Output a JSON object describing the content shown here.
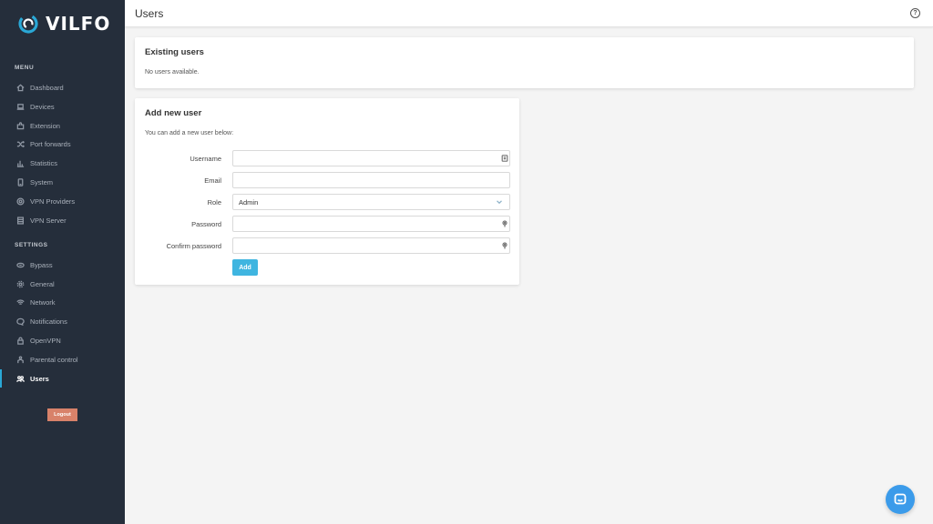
{
  "brand": {
    "name": "VILFO",
    "logo_icon": "vilfo-logo-icon"
  },
  "sidebar": {
    "menu_title": "MENU",
    "menu_items": [
      {
        "label": "Dashboard",
        "icon": "home-icon"
      },
      {
        "label": "Devices",
        "icon": "laptop-icon"
      },
      {
        "label": "Extension",
        "icon": "puzzle-icon"
      },
      {
        "label": "Port forwards",
        "icon": "shuffle-icon"
      },
      {
        "label": "Statistics",
        "icon": "bar-chart-icon"
      },
      {
        "label": "System",
        "icon": "hard-drive-icon"
      },
      {
        "label": "VPN Providers",
        "icon": "globe-icon"
      },
      {
        "label": "VPN Server",
        "icon": "server-icon"
      }
    ],
    "settings_title": "SETTINGS",
    "settings_items": [
      {
        "label": "Bypass",
        "icon": "bypass-icon"
      },
      {
        "label": "General",
        "icon": "gear-icon"
      },
      {
        "label": "Network",
        "icon": "wifi-icon"
      },
      {
        "label": "Notifications",
        "icon": "message-icon"
      },
      {
        "label": "OpenVPN",
        "icon": "lock-icon"
      },
      {
        "label": "Parental control",
        "icon": "family-icon"
      },
      {
        "label": "Users",
        "icon": "users-icon",
        "active": true
      }
    ],
    "logout_label": "Logout"
  },
  "header": {
    "title": "Users",
    "help_icon": "help-circle-icon",
    "help_glyph": "?"
  },
  "existing_users": {
    "title": "Existing users",
    "empty_text": "No users available."
  },
  "add_user": {
    "title": "Add new user",
    "subtitle": "You can add a new user below:",
    "fields": {
      "username": {
        "label": "Username",
        "value": "",
        "icon": "id-card-icon"
      },
      "email": {
        "label": "Email",
        "value": ""
      },
      "role": {
        "label": "Role",
        "value": "Admin",
        "icon": "chevron-down-icon"
      },
      "password": {
        "label": "Password",
        "value": "",
        "icon": "key-icon"
      },
      "confirm_password": {
        "label": "Confirm password",
        "value": "",
        "icon": "key-icon"
      }
    },
    "add_label": "Add"
  },
  "chat": {
    "icon": "chat-icon"
  },
  "colors": {
    "sidebar_bg": "#252e3b",
    "accent": "#3fb5e0",
    "logout": "#d8826a",
    "chat": "#3b9bea",
    "page_bg": "#f4f4f4"
  }
}
